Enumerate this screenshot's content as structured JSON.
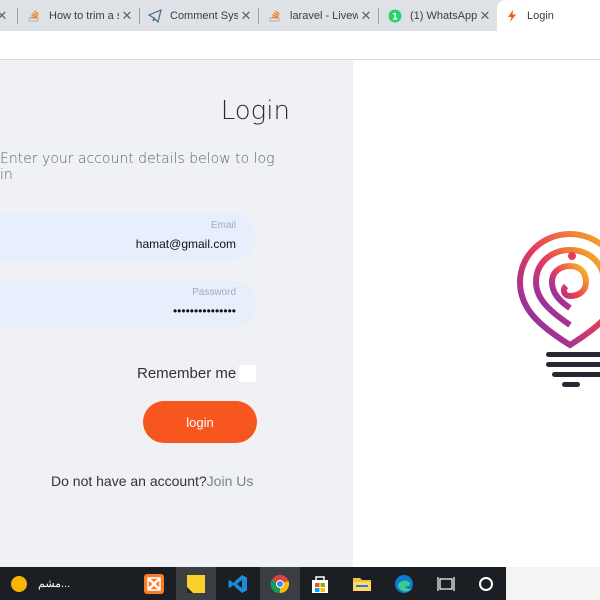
{
  "browser": {
    "tabs": [
      {
        "label": "How to trim a s",
        "icon": "stackoverflow-icon"
      },
      {
        "label": "Comment Syste",
        "icon": "telegram-icon"
      },
      {
        "label": "laravel - Livewi",
        "icon": "stackoverflow-icon"
      },
      {
        "label": "(1) WhatsApp",
        "icon": "whatsapp-icon"
      },
      {
        "label": "Login",
        "icon": "bolt-icon",
        "active": true
      }
    ],
    "close_glyph": "✕"
  },
  "login": {
    "title": "Login",
    "subtitle": "Enter your account details below to log in",
    "email": {
      "label": "Email",
      "value": "hamat@gmail.com"
    },
    "password": {
      "label": "Password",
      "value": "•••••••••••••••"
    },
    "remember_label": "Remember me",
    "remember_checked": false,
    "button_label": "login",
    "signup_text": "Do not have an account?",
    "signup_link": "Join Us"
  },
  "colors": {
    "accent": "#f7561e",
    "field_bg": "#e7eefc",
    "panel_bg": "#f0f1f4"
  },
  "taskbar": {
    "weather_text": "مشم...",
    "items": [
      "xampp-icon",
      "sticky-notes-icon",
      "vscode-icon",
      "chrome-icon",
      "store-icon",
      "file-explorer-icon",
      "edge-icon",
      "task-view-icon",
      "cortana-icon"
    ]
  }
}
